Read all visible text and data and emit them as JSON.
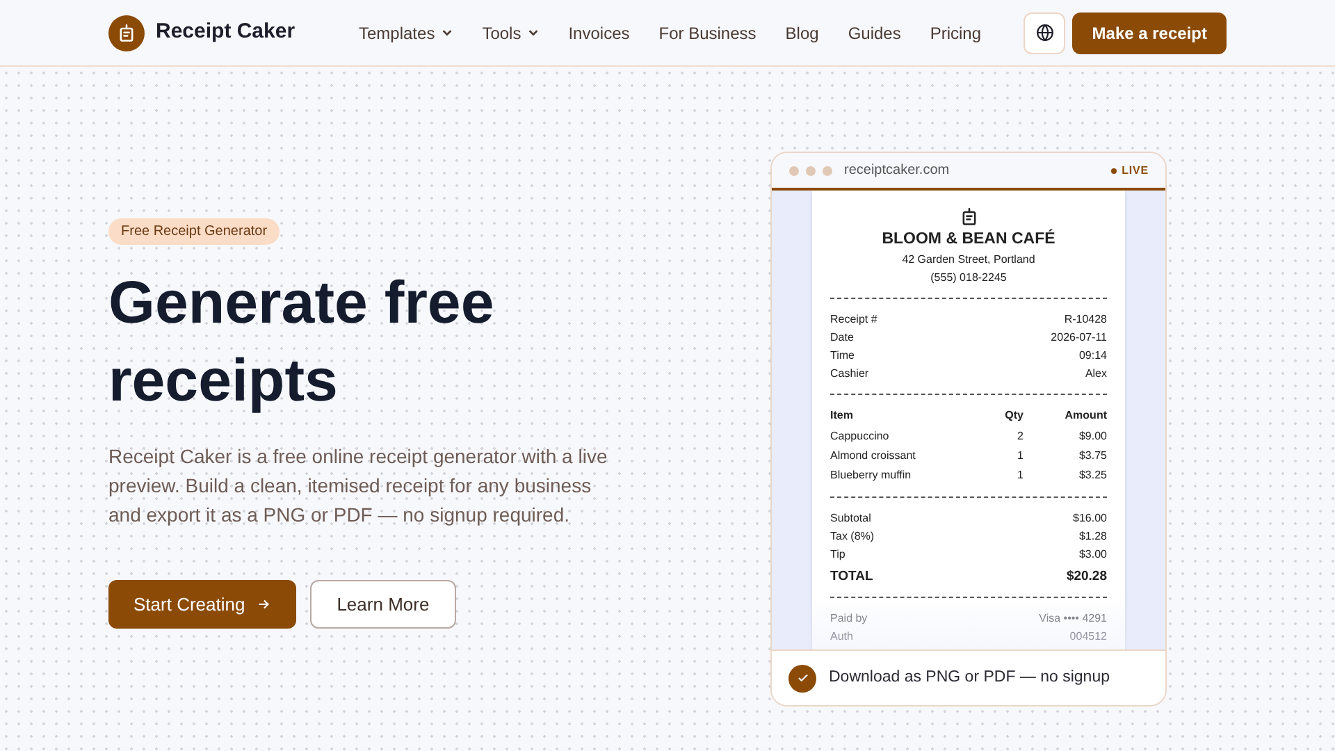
{
  "brand": {
    "name": "Receipt Caker"
  },
  "nav": [
    {
      "label": "Templates",
      "menu": true
    },
    {
      "label": "Tools",
      "menu": true
    },
    {
      "label": "Invoices",
      "menu": false
    },
    {
      "label": "For Business",
      "menu": false
    },
    {
      "label": "Blog",
      "menu": false
    },
    {
      "label": "Guides",
      "menu": false
    },
    {
      "label": "Pricing",
      "menu": false
    }
  ],
  "cta": "Make a receipt",
  "hero": {
    "badge": "Free Receipt Generator",
    "title": "Generate free receipts",
    "description": "Receipt Caker is a free online receipt generator with a live preview. Build a clean, itemised receipt for any business and export it as a PNG or PDF — no signup required.",
    "primary_button": "Start Creating",
    "secondary_button": "Learn More"
  },
  "preview": {
    "url": "receiptcaker.com",
    "status": "LIVE",
    "receipt": {
      "name": "BLOOM & BEAN CAFÉ",
      "address": "42 Garden Street, Portland",
      "phone": "(555) 018-2245",
      "meta": [
        {
          "label": "Receipt #",
          "value": "R-10428"
        },
        {
          "label": "Date",
          "value": "2026-07-11"
        },
        {
          "label": "Time",
          "value": "09:14"
        },
        {
          "label": "Cashier",
          "value": "Alex"
        }
      ],
      "columns": [
        "Item",
        "Qty",
        "Amount"
      ],
      "items": [
        {
          "name": "Cappuccino",
          "qty": "2",
          "amount": "$9.00"
        },
        {
          "name": "Almond croissant",
          "qty": "1",
          "amount": "$3.75"
        },
        {
          "name": "Blueberry muffin",
          "qty": "1",
          "amount": "$3.25"
        }
      ],
      "totals": [
        {
          "label": "Subtotal",
          "value": "$16.00",
          "kind": "line"
        },
        {
          "label": "Tax (8%)",
          "value": "$1.28",
          "kind": "line"
        },
        {
          "label": "Tip",
          "value": "$3.00",
          "kind": "line"
        },
        {
          "label": "TOTAL",
          "value": "$20.28",
          "kind": "total"
        }
      ],
      "payment": [
        {
          "label": "Paid by",
          "value": "Visa •••• 4291"
        },
        {
          "label": "Auth",
          "value": "004512"
        }
      ]
    },
    "footer": "Download as PNG or PDF — no signup"
  }
}
